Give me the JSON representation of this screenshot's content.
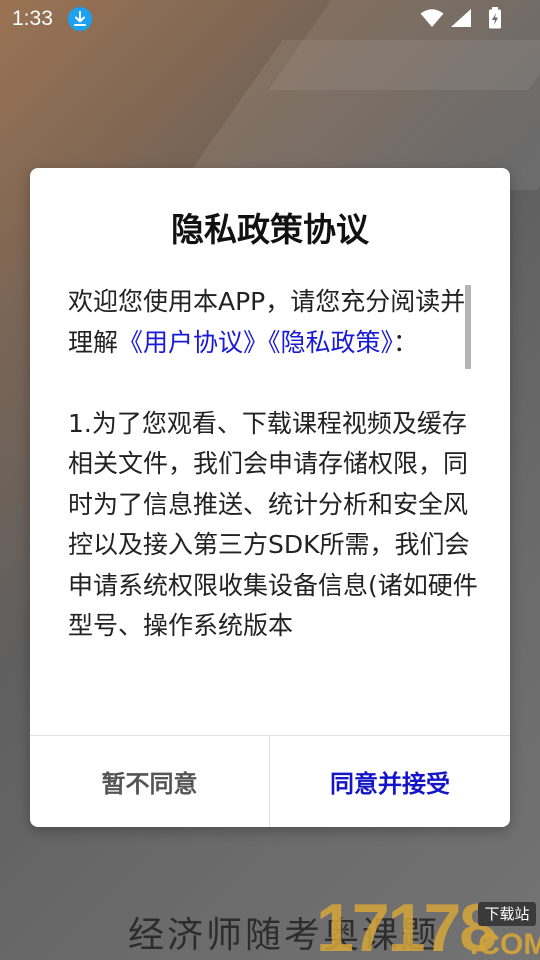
{
  "status_bar": {
    "time": "1:33"
  },
  "dialog": {
    "title": "隐私政策协议",
    "intro_text": "欢迎您使用本APP，请您充分阅读并理解",
    "link_user_agreement": "《用户协议》",
    "link_privacy_policy": "《隐私政策》",
    "intro_suffix": "：",
    "clause_1": "1.为了您观看、下载课程视频及缓存相关文件，我们会申请存储权限，同时为了信息推送、统计分析和安全风控以及接入第三方SDK所需，我们会申请系统权限收集设备信息(诸如硬件型号、操作系统版本",
    "decline_label": "暂不同意",
    "accept_label": "同意并接受"
  },
  "footer": {
    "script_text": "经济师随考奥课题",
    "watermark_number": "17178",
    "watermark_tag": "下载站",
    "watermark_domain": ".COM"
  },
  "colors": {
    "link": "#1a1ad6",
    "accept": "#1515c8",
    "decline": "#555555",
    "watermark": "#d6a63a"
  },
  "icons": [
    "download-icon",
    "wifi-icon",
    "signal-icon",
    "battery-charging-icon"
  ]
}
